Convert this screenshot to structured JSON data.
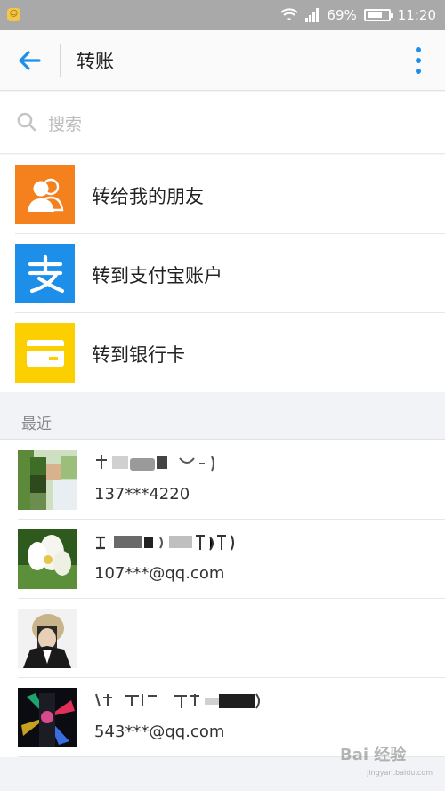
{
  "status_bar": {
    "signal": "69%",
    "time": "11:20"
  },
  "app_bar": {
    "title": "转账"
  },
  "search": {
    "placeholder": "搜索"
  },
  "menu": [
    {
      "label": "转给我的朋友",
      "icon": "contacts-icon",
      "color": "#f5801e"
    },
    {
      "label": "转到支付宝账户",
      "icon": "alipay-icon",
      "color": "#1e8fe8"
    },
    {
      "label": "转到银行卡",
      "icon": "bank-card-icon",
      "color": "#fcd000"
    }
  ],
  "recent": {
    "header": "最近",
    "contacts": [
      {
        "account": "137***4220"
      },
      {
        "account": "107***@qq.com"
      },
      {
        "account": ""
      },
      {
        "account": "543***@qq.com"
      }
    ]
  },
  "watermark": {
    "text": "Bai 经验",
    "url": "jingyan.baidu.com"
  },
  "colors": {
    "accent": "#1e8fe8"
  }
}
